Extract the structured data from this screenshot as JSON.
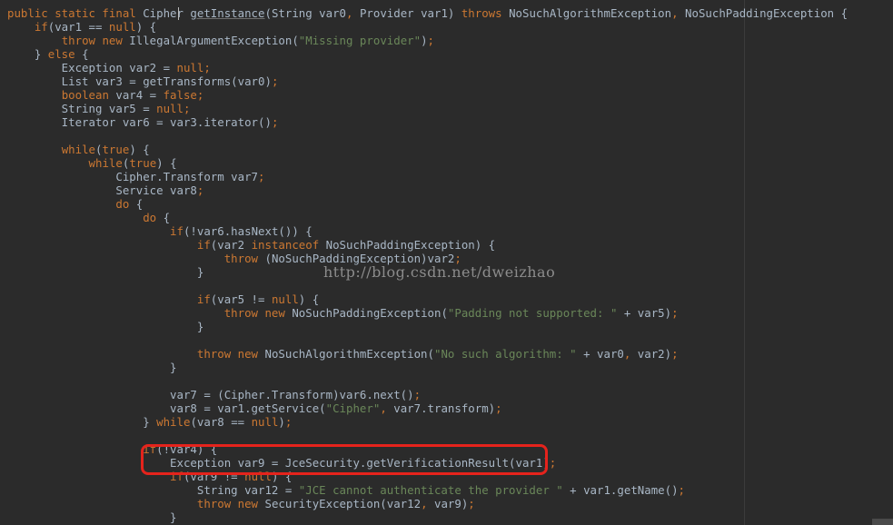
{
  "editor": {
    "lines": [
      [
        {
          "t": "kw",
          "v": "public static final "
        },
        {
          "t": "plain",
          "v": "Cipher "
        },
        {
          "t": "fn",
          "v": "getInstance"
        },
        {
          "t": "plain",
          "v": "(String var0"
        },
        {
          "t": "kw",
          "v": ", "
        },
        {
          "t": "plain",
          "v": "Provider var1) "
        },
        {
          "t": "kw",
          "v": "throws "
        },
        {
          "t": "plain",
          "v": "NoSuchAlgorithmException"
        },
        {
          "t": "kw",
          "v": ", "
        },
        {
          "t": "plain",
          "v": "NoSuchPaddingException {"
        }
      ],
      [
        {
          "t": "plain",
          "v": "    "
        },
        {
          "t": "kw",
          "v": "if"
        },
        {
          "t": "plain",
          "v": "(var1 == "
        },
        {
          "t": "kw",
          "v": "null"
        },
        {
          "t": "plain",
          "v": ") {"
        }
      ],
      [
        {
          "t": "plain",
          "v": "        "
        },
        {
          "t": "kw",
          "v": "throw new "
        },
        {
          "t": "plain",
          "v": "IllegalArgumentException("
        },
        {
          "t": "str",
          "v": "\"Missing provider\""
        },
        {
          "t": "plain",
          "v": ")"
        },
        {
          "t": "kw",
          "v": ";"
        }
      ],
      [
        {
          "t": "plain",
          "v": "    } "
        },
        {
          "t": "kw",
          "v": "else "
        },
        {
          "t": "plain",
          "v": "{"
        }
      ],
      [
        {
          "t": "plain",
          "v": "        Exception var2 = "
        },
        {
          "t": "kw",
          "v": "null;"
        }
      ],
      [
        {
          "t": "plain",
          "v": "        List var3 = getTransforms(var0)"
        },
        {
          "t": "kw",
          "v": ";"
        }
      ],
      [
        {
          "t": "plain",
          "v": "        "
        },
        {
          "t": "kw",
          "v": "boolean "
        },
        {
          "t": "plain",
          "v": "var4 = "
        },
        {
          "t": "kw",
          "v": "false;"
        }
      ],
      [
        {
          "t": "plain",
          "v": "        String var5 = "
        },
        {
          "t": "kw",
          "v": "null;"
        }
      ],
      [
        {
          "t": "plain",
          "v": "        Iterator var6 = var3.iterator()"
        },
        {
          "t": "kw",
          "v": ";"
        }
      ],
      [
        {
          "t": "plain",
          "v": ""
        }
      ],
      [
        {
          "t": "plain",
          "v": "        "
        },
        {
          "t": "kw",
          "v": "while"
        },
        {
          "t": "plain",
          "v": "("
        },
        {
          "t": "kw",
          "v": "true"
        },
        {
          "t": "plain",
          "v": ") {"
        }
      ],
      [
        {
          "t": "plain",
          "v": "            "
        },
        {
          "t": "kw",
          "v": "while"
        },
        {
          "t": "plain",
          "v": "("
        },
        {
          "t": "kw",
          "v": "true"
        },
        {
          "t": "plain",
          "v": ") {"
        }
      ],
      [
        {
          "t": "plain",
          "v": "                Cipher.Transform var7"
        },
        {
          "t": "kw",
          "v": ";"
        }
      ],
      [
        {
          "t": "plain",
          "v": "                Service var8"
        },
        {
          "t": "kw",
          "v": ";"
        }
      ],
      [
        {
          "t": "plain",
          "v": "                "
        },
        {
          "t": "kw",
          "v": "do "
        },
        {
          "t": "plain",
          "v": "{"
        }
      ],
      [
        {
          "t": "plain",
          "v": "                    "
        },
        {
          "t": "kw",
          "v": "do "
        },
        {
          "t": "plain",
          "v": "{"
        }
      ],
      [
        {
          "t": "plain",
          "v": "                        "
        },
        {
          "t": "kw",
          "v": "if"
        },
        {
          "t": "plain",
          "v": "(!var6.hasNext()) {"
        }
      ],
      [
        {
          "t": "plain",
          "v": "                            "
        },
        {
          "t": "kw",
          "v": "if"
        },
        {
          "t": "plain",
          "v": "(var2 "
        },
        {
          "t": "kw",
          "v": "instanceof "
        },
        {
          "t": "plain",
          "v": "NoSuchPaddingException) {"
        }
      ],
      [
        {
          "t": "plain",
          "v": "                                "
        },
        {
          "t": "kw",
          "v": "throw "
        },
        {
          "t": "plain",
          "v": "(NoSuchPaddingException)var2"
        },
        {
          "t": "kw",
          "v": ";"
        }
      ],
      [
        {
          "t": "plain",
          "v": "                            }"
        }
      ],
      [
        {
          "t": "plain",
          "v": ""
        }
      ],
      [
        {
          "t": "plain",
          "v": "                            "
        },
        {
          "t": "kw",
          "v": "if"
        },
        {
          "t": "plain",
          "v": "(var5 != "
        },
        {
          "t": "kw",
          "v": "null"
        },
        {
          "t": "plain",
          "v": ") {"
        }
      ],
      [
        {
          "t": "plain",
          "v": "                                "
        },
        {
          "t": "kw",
          "v": "throw new "
        },
        {
          "t": "plain",
          "v": "NoSuchPaddingException("
        },
        {
          "t": "str",
          "v": "\"Padding not supported: \""
        },
        {
          "t": "plain",
          "v": " + var5)"
        },
        {
          "t": "kw",
          "v": ";"
        }
      ],
      [
        {
          "t": "plain",
          "v": "                            }"
        }
      ],
      [
        {
          "t": "plain",
          "v": ""
        }
      ],
      [
        {
          "t": "plain",
          "v": "                            "
        },
        {
          "t": "kw",
          "v": "throw new "
        },
        {
          "t": "plain",
          "v": "NoSuchAlgorithmException("
        },
        {
          "t": "str",
          "v": "\"No such algorithm: \""
        },
        {
          "t": "plain",
          "v": " + var0"
        },
        {
          "t": "kw",
          "v": ", "
        },
        {
          "t": "plain",
          "v": "var2)"
        },
        {
          "t": "kw",
          "v": ";"
        }
      ],
      [
        {
          "t": "plain",
          "v": "                        }"
        }
      ],
      [
        {
          "t": "plain",
          "v": ""
        }
      ],
      [
        {
          "t": "plain",
          "v": "                        var7 = (Cipher.Transform)var6.next()"
        },
        {
          "t": "kw",
          "v": ";"
        }
      ],
      [
        {
          "t": "plain",
          "v": "                        var8 = var1.getService("
        },
        {
          "t": "str",
          "v": "\"Cipher\""
        },
        {
          "t": "kw",
          "v": ", "
        },
        {
          "t": "plain",
          "v": "var7.transform)"
        },
        {
          "t": "kw",
          "v": ";"
        }
      ],
      [
        {
          "t": "plain",
          "v": "                    } "
        },
        {
          "t": "kw",
          "v": "while"
        },
        {
          "t": "plain",
          "v": "(var8 == "
        },
        {
          "t": "kw",
          "v": "null"
        },
        {
          "t": "plain",
          "v": ")"
        },
        {
          "t": "kw",
          "v": ";"
        }
      ],
      [
        {
          "t": "plain",
          "v": ""
        }
      ],
      [
        {
          "t": "plain",
          "v": "                    "
        },
        {
          "t": "kw",
          "v": "if"
        },
        {
          "t": "plain",
          "v": "(!var4) {"
        }
      ],
      [
        {
          "t": "plain",
          "v": "                        Exception var9 = JceSecurity.getVerificationResult(var1)"
        },
        {
          "t": "kw",
          "v": ";"
        }
      ],
      [
        {
          "t": "plain",
          "v": "                        "
        },
        {
          "t": "kw",
          "v": "if"
        },
        {
          "t": "plain",
          "v": "(var9 != "
        },
        {
          "t": "kw",
          "v": "null"
        },
        {
          "t": "plain",
          "v": ") {"
        }
      ],
      [
        {
          "t": "plain",
          "v": "                            String var12 = "
        },
        {
          "t": "str",
          "v": "\"JCE cannot authenticate the provider \""
        },
        {
          "t": "plain",
          "v": " + var1.getName()"
        },
        {
          "t": "kw",
          "v": ";"
        }
      ],
      [
        {
          "t": "plain",
          "v": "                            "
        },
        {
          "t": "kw",
          "v": "throw new "
        },
        {
          "t": "plain",
          "v": "SecurityException(var12"
        },
        {
          "t": "kw",
          "v": ", "
        },
        {
          "t": "plain",
          "v": "var9)"
        },
        {
          "t": "kw",
          "v": ";"
        }
      ],
      [
        {
          "t": "plain",
          "v": "                        }"
        }
      ]
    ]
  },
  "watermark": {
    "text": "http://blog.csdn.net/dweizhao"
  },
  "colors": {
    "background": "#2b2b2b",
    "keyword": "#cc7832",
    "string": "#6a8759",
    "plain": "#a9b7c6",
    "highlight_border": "#e5231c"
  }
}
